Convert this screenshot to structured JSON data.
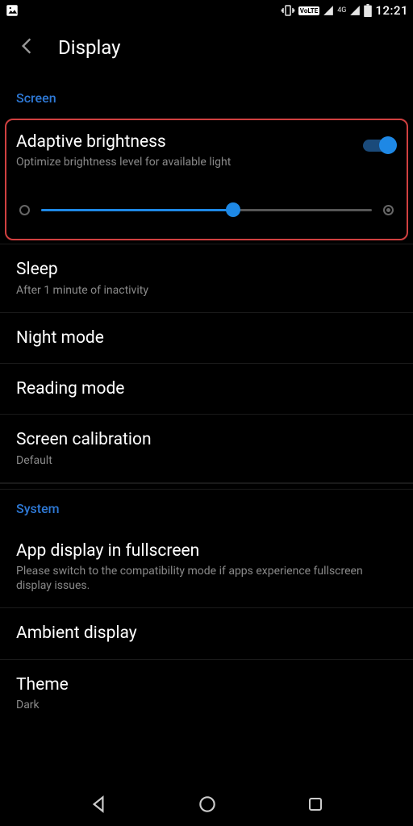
{
  "status": {
    "clock": "12:21",
    "net_label": "4G",
    "volte": "VoLTE"
  },
  "header": {
    "title": "Display"
  },
  "sections": {
    "screen": {
      "label": "Screen",
      "adaptive": {
        "title": "Adaptive brightness",
        "sub": "Optimize brightness level for available light",
        "on": true,
        "slider_percent": 58
      },
      "sleep": {
        "title": "Sleep",
        "sub": "After 1 minute of inactivity"
      },
      "night_mode": {
        "title": "Night mode"
      },
      "reading_mode": {
        "title": "Reading mode"
      },
      "screen_cal": {
        "title": "Screen calibration",
        "sub": "Default"
      }
    },
    "system": {
      "label": "System",
      "fullscreen": {
        "title": "App display in fullscreen",
        "sub": "Please switch to the compatibility mode if apps experience fullscreen display issues."
      },
      "ambient": {
        "title": "Ambient display"
      },
      "theme": {
        "title": "Theme",
        "sub": "Dark"
      }
    }
  },
  "colors": {
    "accent": "#1e88e5",
    "highlight_border": "#d04040",
    "section_header": "#2e79d6"
  }
}
